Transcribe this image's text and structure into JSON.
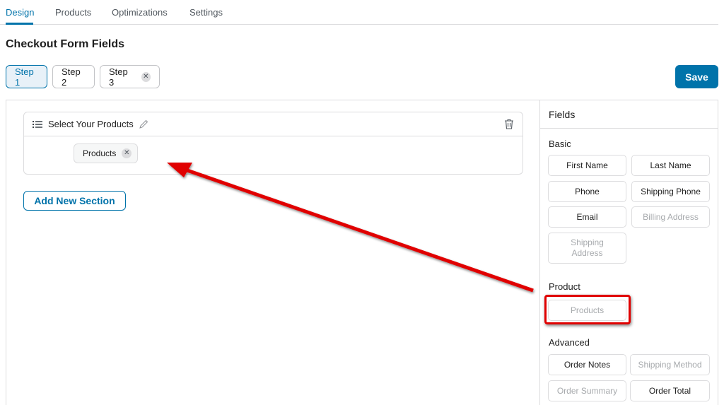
{
  "tabs": [
    {
      "label": "Design",
      "active": true
    },
    {
      "label": "Products"
    },
    {
      "label": "Optimizations"
    },
    {
      "label": "Settings"
    }
  ],
  "page_title": "Checkout Form Fields",
  "steps": [
    {
      "label": "Step 1",
      "active": true
    },
    {
      "label": "Step 2"
    },
    {
      "label": "Step 3",
      "removable": true
    }
  ],
  "save_label": "Save",
  "section": {
    "title": "Select Your Products",
    "field_chip": "Products"
  },
  "add_section_label": "Add New Section",
  "fields_panel": {
    "header": "Fields",
    "groups": {
      "basic": {
        "label": "Basic",
        "items": [
          "First Name",
          "Last Name",
          "Phone",
          "Shipping Phone",
          "Email",
          "Billing Address",
          "Shipping Address"
        ]
      },
      "product": {
        "label": "Product",
        "items": [
          "Products"
        ]
      },
      "advanced": {
        "label": "Advanced",
        "items": [
          "Order Notes",
          "Shipping Method",
          "Order Summary",
          "Order Total"
        ]
      }
    }
  },
  "colors": {
    "accent": "#0073aa",
    "annotation": "#e00000"
  }
}
